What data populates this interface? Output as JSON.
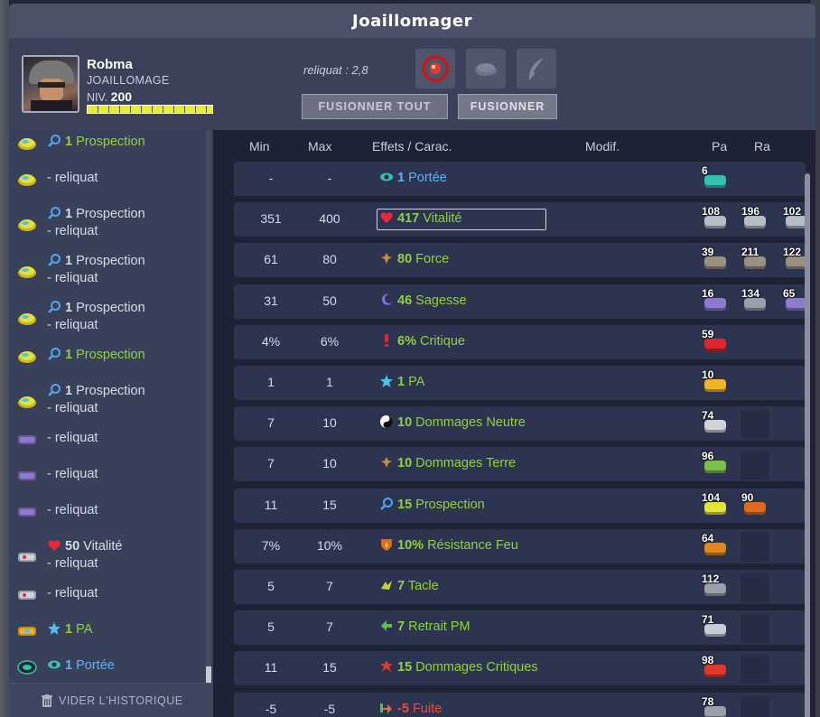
{
  "window": {
    "title": "Joaillomager"
  },
  "player": {
    "name": "Robma",
    "job": "JOAILLOMAGE",
    "level_label": "NIV.",
    "level": "200",
    "xp_fraction": 0.98
  },
  "reliquat": "reliquat : 2,8",
  "buttons": {
    "fuse_all": "FUSIONNER TOUT",
    "fuse": "FUSIONNER"
  },
  "history_footer": "VIDER L'HISTORIQUE",
  "history": [
    {
      "icon": "prospection-rune-icon",
      "effect_num": "1",
      "effect_name": "Prospection",
      "effect_color": "green",
      "reliquat": ""
    },
    {
      "icon": "prospection-rune-icon",
      "effect_num": "",
      "effect_name": "",
      "reliquat": "- reliquat"
    },
    {
      "icon": "prospection-rune-icon",
      "effect_num": "1",
      "effect_name": "Prospection",
      "effect_color": "white",
      "reliquat": "- reliquat"
    },
    {
      "icon": "prospection-rune-icon",
      "effect_num": "1",
      "effect_name": "Prospection",
      "effect_color": "white",
      "reliquat": "- reliquat"
    },
    {
      "icon": "prospection-rune-icon",
      "effect_num": "1",
      "effect_name": "Prospection",
      "effect_color": "white",
      "reliquat": "- reliquat"
    },
    {
      "icon": "prospection-rune-icon",
      "effect_num": "1",
      "effect_name": "Prospection",
      "effect_color": "green",
      "reliquat": ""
    },
    {
      "icon": "prospection-rune-icon",
      "effect_num": "1",
      "effect_name": "Prospection",
      "effect_color": "white",
      "reliquat": "- reliquat"
    },
    {
      "icon": "sagesse-rune-icon",
      "effect_num": "",
      "effect_name": "",
      "reliquat": "- reliquat"
    },
    {
      "icon": "sagesse-rune-icon",
      "effect_num": "",
      "effect_name": "",
      "reliquat": "- reliquat"
    },
    {
      "icon": "sagesse-rune-icon",
      "effect_num": "",
      "effect_name": "",
      "reliquat": "- reliquat"
    },
    {
      "icon": "vitalite-rune-icon",
      "effect_num": "50",
      "effect_name": "Vitalité",
      "effect_color": "white",
      "reliquat": "- reliquat"
    },
    {
      "icon": "vitalite-rune-icon",
      "effect_num": "",
      "effect_name": "",
      "reliquat": "- reliquat"
    },
    {
      "icon": "pa-rune-icon",
      "effect_num": "1",
      "effect_name": "PA",
      "effect_color": "green",
      "reliquat": ""
    },
    {
      "icon": "portee-rune-icon",
      "effect_num": "1",
      "effect_name": "Portée",
      "effect_color": "blue",
      "reliquat": ""
    }
  ],
  "columns": {
    "min": "Min",
    "max": "Max",
    "effects": "Effets / Carac.",
    "modif": "Modif.",
    "pa": "Pa",
    "ra": "Ra"
  },
  "rows": [
    {
      "min": "-",
      "max": "-",
      "num": "1",
      "name": "Portée",
      "icon": "eye-icon",
      "color": "blue",
      "runes": [
        "6",
        "",
        ""
      ]
    },
    {
      "min": "351",
      "max": "400",
      "num": "417",
      "name": "Vitalité",
      "icon": "heart-icon",
      "color": "green",
      "selected": true,
      "runes": [
        "108",
        "196",
        "102"
      ]
    },
    {
      "min": "61",
      "max": "80",
      "num": "80",
      "name": "Force",
      "icon": "force-icon",
      "color": "green",
      "runes": [
        "39",
        "211",
        "122"
      ]
    },
    {
      "min": "31",
      "max": "50",
      "num": "46",
      "name": "Sagesse",
      "icon": "moon-icon",
      "color": "green",
      "runes": [
        "16",
        "134",
        "65"
      ]
    },
    {
      "min": "4%",
      "max": "6%",
      "num": "6%",
      "name": "Critique",
      "icon": "exclamation-icon",
      "color": "green",
      "runes": [
        "59",
        "",
        ""
      ]
    },
    {
      "min": "1",
      "max": "1",
      "num": "1",
      "name": "PA",
      "icon": "star-icon",
      "color": "green",
      "runes": [
        "10",
        "",
        ""
      ]
    },
    {
      "min": "7",
      "max": "10",
      "num": "10",
      "name": "Dommages Neutre",
      "icon": "yin-yang-icon",
      "color": "green",
      "runes": [
        "74",
        "",
        ""
      ]
    },
    {
      "min": "7",
      "max": "10",
      "num": "10",
      "name": "Dommages Terre",
      "icon": "force-icon",
      "color": "green",
      "runes": [
        "96",
        "",
        ""
      ]
    },
    {
      "min": "11",
      "max": "15",
      "num": "15",
      "name": "Prospection",
      "icon": "magnifier-icon",
      "color": "green",
      "runes": [
        "104",
        "90",
        ""
      ]
    },
    {
      "min": "7%",
      "max": "10%",
      "num": "10%",
      "name": "Résistance Feu",
      "icon": "fire-shield-icon",
      "color": "green",
      "runes": [
        "64",
        "",
        ""
      ]
    },
    {
      "min": "5",
      "max": "7",
      "num": "7",
      "name": "Tacle",
      "icon": "tacle-icon",
      "color": "green",
      "runes": [
        "112",
        "",
        ""
      ]
    },
    {
      "min": "5",
      "max": "7",
      "num": "7",
      "name": "Retrait PM",
      "icon": "retrait-pm-icon",
      "color": "green",
      "runes": [
        "71",
        "",
        ""
      ]
    },
    {
      "min": "11",
      "max": "15",
      "num": "15",
      "name": "Dommages Critiques",
      "icon": "crit-dmg-icon",
      "color": "green",
      "runes": [
        "98",
        "",
        ""
      ]
    },
    {
      "min": "-5",
      "max": "-5",
      "num": "-5",
      "name": "Fuite",
      "icon": "fuite-icon",
      "color": "red",
      "runes": [
        "78",
        "",
        ""
      ]
    }
  ]
}
